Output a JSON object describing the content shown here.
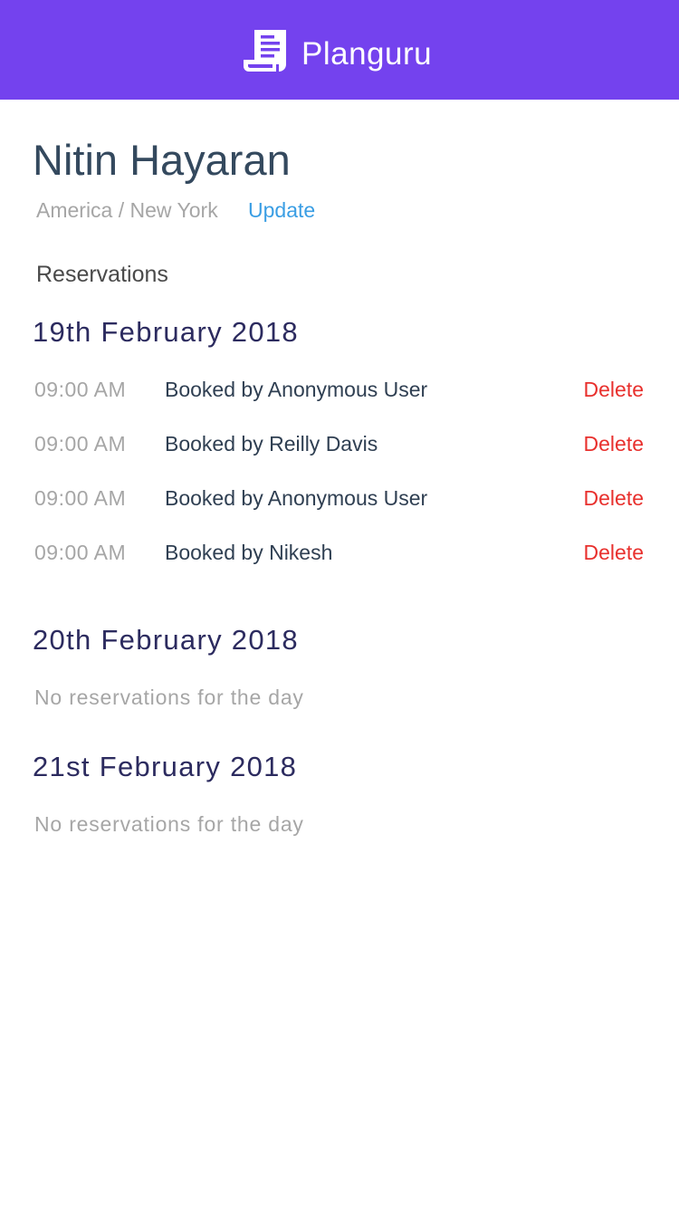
{
  "header": {
    "title": "Planguru",
    "logo_icon": "receipt-icon",
    "background_color": "#7442ee"
  },
  "user": {
    "name": "Nitin Hayaran",
    "timezone": "America / New York",
    "update_label": "Update"
  },
  "reservations_label": "Reservations",
  "days": [
    {
      "title": "19th February 2018",
      "reservations": [
        {
          "time": "09:00 AM",
          "booked_by": "Booked by Anonymous User",
          "delete_label": "Delete"
        },
        {
          "time": "09:00 AM",
          "booked_by": "Booked by Reilly Davis",
          "delete_label": "Delete"
        },
        {
          "time": "09:00 AM",
          "booked_by": "Booked by Anonymous User",
          "delete_label": "Delete"
        },
        {
          "time": "09:00 AM",
          "booked_by": "Booked by Nikesh",
          "delete_label": "Delete"
        }
      ]
    },
    {
      "title": "20th February 2018",
      "empty_message": "No reservations for the day"
    },
    {
      "title": "21st February 2018",
      "empty_message": "No reservations for the day"
    }
  ],
  "colors": {
    "accent": "#7442ee",
    "link": "#3a9ee4",
    "danger": "#e8302d",
    "heading": "#2c2b5f"
  }
}
